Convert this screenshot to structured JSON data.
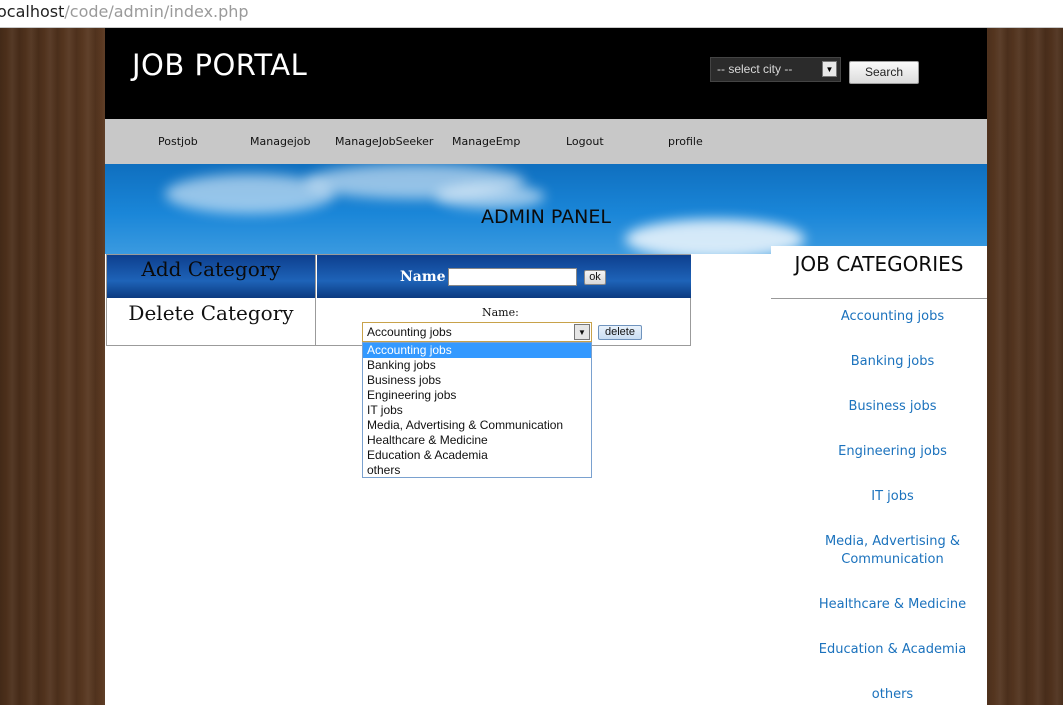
{
  "browser": {
    "url_prefix": "ocalhost",
    "url_path": "/code/admin/index.php"
  },
  "header": {
    "logo": "JOB PORTAL",
    "city_select_value": "-- select city --",
    "search_label": "Search"
  },
  "nav": {
    "items": [
      "Postjob",
      "Managejob",
      "ManageJobSeeker",
      "ManageEmp",
      "Logout",
      "profile"
    ]
  },
  "banner": {
    "title": "ADMIN PANEL"
  },
  "admin": {
    "add_category": "Add Category",
    "name_label": "Name",
    "ok_label": "ok",
    "delete_category": "Delete Category",
    "delete_name_label": "Name:",
    "selected_category": "Accounting jobs",
    "delete_label": "delete",
    "options": [
      "Accounting jobs",
      "Banking jobs",
      "Business jobs",
      "Engineering jobs",
      "IT jobs",
      "Media, Advertising & Communication",
      "Healthcare & Medicine",
      "Education & Academia",
      "others"
    ]
  },
  "sidebar": {
    "title": "JOB CATEGORIES",
    "items": [
      "Accounting jobs",
      "Banking jobs",
      "Business jobs",
      "Engineering jobs",
      "IT jobs",
      "Media, Advertising &",
      "Communication",
      "Healthcare & Medicine",
      "Education & Academia",
      "others"
    ]
  }
}
